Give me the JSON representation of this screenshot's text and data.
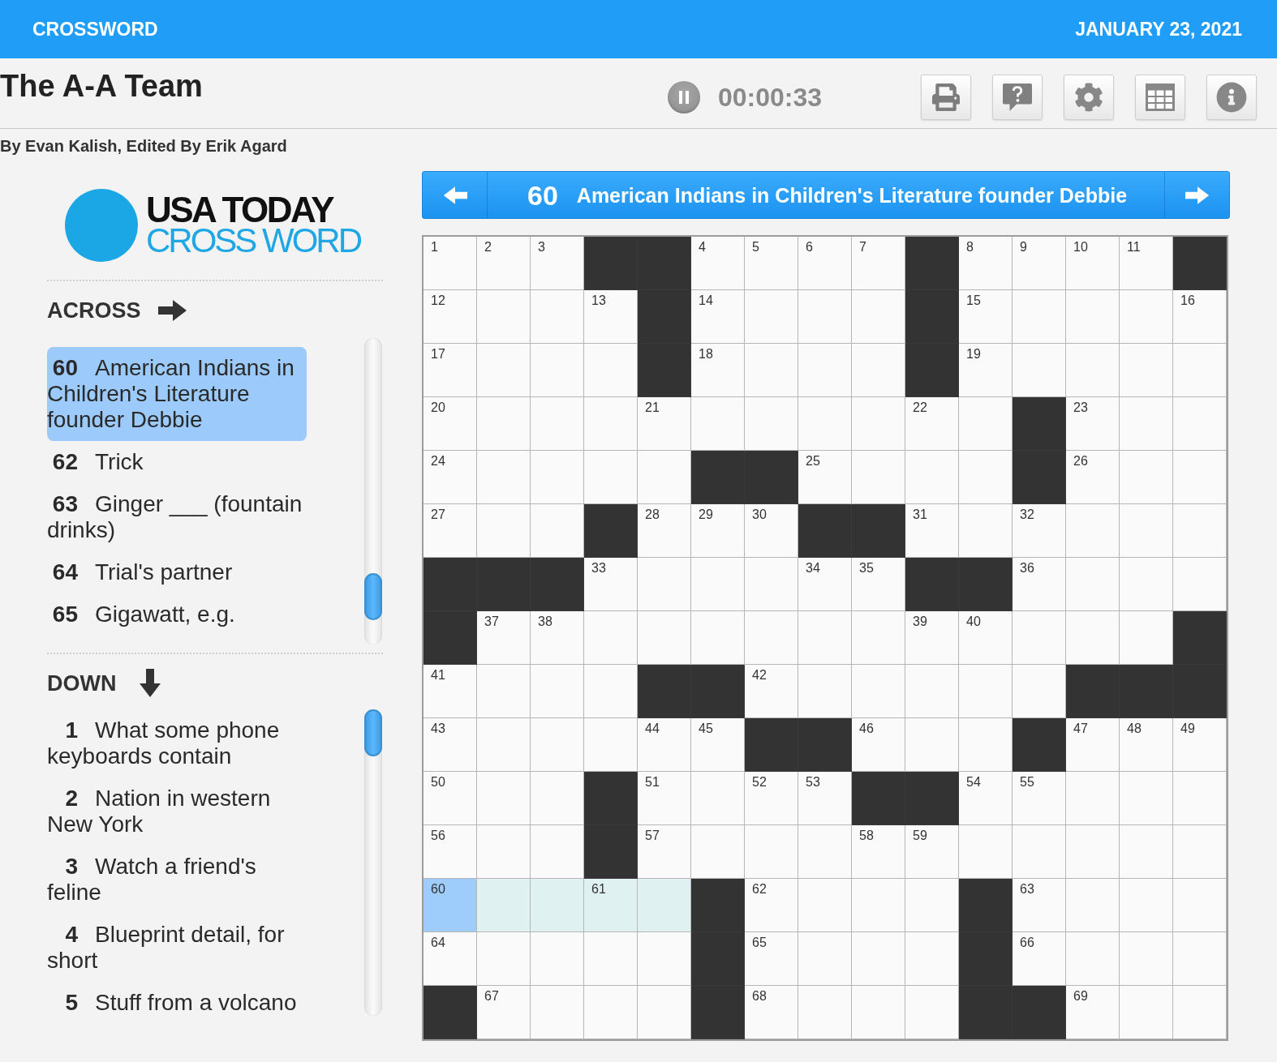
{
  "header": {
    "section": "CROSSWORD",
    "date": "JANUARY 23, 2021"
  },
  "puzzle": {
    "title": "The A-A Team",
    "byline": "By Evan Kalish, Edited By Erik Agard"
  },
  "timer": {
    "running": true,
    "time": "00:00:33"
  },
  "logo": {
    "line_1": "USA TODAY",
    "line_2": "CROSS WORD"
  },
  "across": {
    "heading": "ACROSS",
    "clues": [
      {
        "number": "60",
        "text": "American Indians in Children's Literature founder Debbie",
        "selected": true
      },
      {
        "number": "62",
        "text": "Trick",
        "selected": false
      },
      {
        "number": "63",
        "text": "Ginger ___ (fountain drinks)",
        "selected": false
      },
      {
        "number": "64",
        "text": "Trial's partner",
        "selected": false
      },
      {
        "number": "65",
        "text": "Gigawatt, e.g.",
        "selected": false
      }
    ]
  },
  "down": {
    "heading": "DOWN",
    "clues": [
      {
        "number": "1",
        "text": "What some phone keyboards contain",
        "selected": false
      },
      {
        "number": "2",
        "text": "Nation in western New York",
        "selected": false
      },
      {
        "number": "3",
        "text": "Watch a friend's feline",
        "selected": false
      },
      {
        "number": "4",
        "text": "Blueprint detail, for short",
        "selected": false
      },
      {
        "number": "5",
        "text": "Stuff from a volcano",
        "selected": false
      }
    ]
  },
  "clue_bar": {
    "number": "60",
    "text": "American Indians in Children's Literature founder Debbie"
  },
  "grid": {
    "rows": [
      [
        {
          "kind": "open",
          "number": "1",
          "selected": false,
          "highlighted": false
        },
        {
          "kind": "open",
          "number": "2",
          "selected": false,
          "highlighted": false
        },
        {
          "kind": "open",
          "number": "3",
          "selected": false,
          "highlighted": false
        },
        {
          "kind": "block"
        },
        {
          "kind": "block"
        },
        {
          "kind": "open",
          "number": "4",
          "selected": false,
          "highlighted": false
        },
        {
          "kind": "open",
          "number": "5",
          "selected": false,
          "highlighted": false
        },
        {
          "kind": "open",
          "number": "6",
          "selected": false,
          "highlighted": false
        },
        {
          "kind": "open",
          "number": "7",
          "selected": false,
          "highlighted": false
        },
        {
          "kind": "block"
        },
        {
          "kind": "open",
          "number": "8",
          "selected": false,
          "highlighted": false
        },
        {
          "kind": "open",
          "number": "9",
          "selected": false,
          "highlighted": false
        },
        {
          "kind": "open",
          "number": "10",
          "selected": false,
          "highlighted": false
        },
        {
          "kind": "open",
          "number": "11",
          "selected": false,
          "highlighted": false
        },
        {
          "kind": "block"
        }
      ],
      [
        {
          "kind": "open",
          "number": "12",
          "selected": false,
          "highlighted": false
        },
        {
          "kind": "open",
          "selected": false,
          "highlighted": false
        },
        {
          "kind": "open",
          "selected": false,
          "highlighted": false
        },
        {
          "kind": "open",
          "number": "13",
          "selected": false,
          "highlighted": false
        },
        {
          "kind": "block"
        },
        {
          "kind": "open",
          "number": "14",
          "selected": false,
          "highlighted": false
        },
        {
          "kind": "open",
          "selected": false,
          "highlighted": false
        },
        {
          "kind": "open",
          "selected": false,
          "highlighted": false
        },
        {
          "kind": "open",
          "selected": false,
          "highlighted": false
        },
        {
          "kind": "block"
        },
        {
          "kind": "open",
          "number": "15",
          "selected": false,
          "highlighted": false
        },
        {
          "kind": "open",
          "selected": false,
          "highlighted": false
        },
        {
          "kind": "open",
          "selected": false,
          "highlighted": false
        },
        {
          "kind": "open",
          "selected": false,
          "highlighted": false
        },
        {
          "kind": "open",
          "number": "16",
          "selected": false,
          "highlighted": false
        }
      ],
      [
        {
          "kind": "open",
          "number": "17",
          "selected": false,
          "highlighted": false
        },
        {
          "kind": "open",
          "selected": false,
          "highlighted": false
        },
        {
          "kind": "open",
          "selected": false,
          "highlighted": false
        },
        {
          "kind": "open",
          "selected": false,
          "highlighted": false
        },
        {
          "kind": "block"
        },
        {
          "kind": "open",
          "number": "18",
          "selected": false,
          "highlighted": false
        },
        {
          "kind": "open",
          "selected": false,
          "highlighted": false
        },
        {
          "kind": "open",
          "selected": false,
          "highlighted": false
        },
        {
          "kind": "open",
          "selected": false,
          "highlighted": false
        },
        {
          "kind": "block"
        },
        {
          "kind": "open",
          "number": "19",
          "selected": false,
          "highlighted": false
        },
        {
          "kind": "open",
          "selected": false,
          "highlighted": false
        },
        {
          "kind": "open",
          "selected": false,
          "highlighted": false
        },
        {
          "kind": "open",
          "selected": false,
          "highlighted": false
        },
        {
          "kind": "open",
          "selected": false,
          "highlighted": false
        }
      ],
      [
        {
          "kind": "open",
          "number": "20",
          "selected": false,
          "highlighted": false
        },
        {
          "kind": "open",
          "selected": false,
          "highlighted": false
        },
        {
          "kind": "open",
          "selected": false,
          "highlighted": false
        },
        {
          "kind": "open",
          "selected": false,
          "highlighted": false
        },
        {
          "kind": "open",
          "number": "21",
          "selected": false,
          "highlighted": false
        },
        {
          "kind": "open",
          "selected": false,
          "highlighted": false
        },
        {
          "kind": "open",
          "selected": false,
          "highlighted": false
        },
        {
          "kind": "open",
          "selected": false,
          "highlighted": false
        },
        {
          "kind": "open",
          "selected": false,
          "highlighted": false
        },
        {
          "kind": "open",
          "number": "22",
          "selected": false,
          "highlighted": false
        },
        {
          "kind": "open",
          "selected": false,
          "highlighted": false
        },
        {
          "kind": "block"
        },
        {
          "kind": "open",
          "number": "23",
          "selected": false,
          "highlighted": false
        },
        {
          "kind": "open",
          "selected": false,
          "highlighted": false
        },
        {
          "kind": "open",
          "selected": false,
          "highlighted": false
        }
      ],
      [
        {
          "kind": "open",
          "number": "24",
          "selected": false,
          "highlighted": false
        },
        {
          "kind": "open",
          "selected": false,
          "highlighted": false
        },
        {
          "kind": "open",
          "selected": false,
          "highlighted": false
        },
        {
          "kind": "open",
          "selected": false,
          "highlighted": false
        },
        {
          "kind": "open",
          "selected": false,
          "highlighted": false
        },
        {
          "kind": "block"
        },
        {
          "kind": "block"
        },
        {
          "kind": "open",
          "number": "25",
          "selected": false,
          "highlighted": false
        },
        {
          "kind": "open",
          "selected": false,
          "highlighted": false
        },
        {
          "kind": "open",
          "selected": false,
          "highlighted": false
        },
        {
          "kind": "open",
          "selected": false,
          "highlighted": false
        },
        {
          "kind": "block"
        },
        {
          "kind": "open",
          "number": "26",
          "selected": false,
          "highlighted": false
        },
        {
          "kind": "open",
          "selected": false,
          "highlighted": false
        },
        {
          "kind": "open",
          "selected": false,
          "highlighted": false
        }
      ],
      [
        {
          "kind": "open",
          "number": "27",
          "selected": false,
          "highlighted": false
        },
        {
          "kind": "open",
          "selected": false,
          "highlighted": false
        },
        {
          "kind": "open",
          "selected": false,
          "highlighted": false
        },
        {
          "kind": "block"
        },
        {
          "kind": "open",
          "number": "28",
          "selected": false,
          "highlighted": false
        },
        {
          "kind": "open",
          "number": "29",
          "selected": false,
          "highlighted": false
        },
        {
          "kind": "open",
          "number": "30",
          "selected": false,
          "highlighted": false
        },
        {
          "kind": "block"
        },
        {
          "kind": "block"
        },
        {
          "kind": "open",
          "number": "31",
          "selected": false,
          "highlighted": false
        },
        {
          "kind": "open",
          "selected": false,
          "highlighted": false
        },
        {
          "kind": "open",
          "number": "32",
          "selected": false,
          "highlighted": false
        },
        {
          "kind": "open",
          "selected": false,
          "highlighted": false
        },
        {
          "kind": "open",
          "selected": false,
          "highlighted": false
        },
        {
          "kind": "open",
          "selected": false,
          "highlighted": false
        }
      ],
      [
        {
          "kind": "block"
        },
        {
          "kind": "block"
        },
        {
          "kind": "block"
        },
        {
          "kind": "open",
          "number": "33",
          "selected": false,
          "highlighted": false
        },
        {
          "kind": "open",
          "selected": false,
          "highlighted": false
        },
        {
          "kind": "open",
          "selected": false,
          "highlighted": false
        },
        {
          "kind": "open",
          "selected": false,
          "highlighted": false
        },
        {
          "kind": "open",
          "number": "34",
          "selected": false,
          "highlighted": false
        },
        {
          "kind": "open",
          "number": "35",
          "selected": false,
          "highlighted": false
        },
        {
          "kind": "block"
        },
        {
          "kind": "block"
        },
        {
          "kind": "open",
          "number": "36",
          "selected": false,
          "highlighted": false
        },
        {
          "kind": "open",
          "selected": false,
          "highlighted": false
        },
        {
          "kind": "open",
          "selected": false,
          "highlighted": false
        },
        {
          "kind": "open",
          "selected": false,
          "highlighted": false
        }
      ],
      [
        {
          "kind": "block"
        },
        {
          "kind": "open",
          "number": "37",
          "selected": false,
          "highlighted": false
        },
        {
          "kind": "open",
          "number": "38",
          "selected": false,
          "highlighted": false
        },
        {
          "kind": "open",
          "selected": false,
          "highlighted": false
        },
        {
          "kind": "open",
          "selected": false,
          "highlighted": false
        },
        {
          "kind": "open",
          "selected": false,
          "highlighted": false
        },
        {
          "kind": "open",
          "selected": false,
          "highlighted": false
        },
        {
          "kind": "open",
          "selected": false,
          "highlighted": false
        },
        {
          "kind": "open",
          "selected": false,
          "highlighted": false
        },
        {
          "kind": "open",
          "number": "39",
          "selected": false,
          "highlighted": false
        },
        {
          "kind": "open",
          "number": "40",
          "selected": false,
          "highlighted": false
        },
        {
          "kind": "open",
          "selected": false,
          "highlighted": false
        },
        {
          "kind": "open",
          "selected": false,
          "highlighted": false
        },
        {
          "kind": "open",
          "selected": false,
          "highlighted": false
        },
        {
          "kind": "block"
        }
      ],
      [
        {
          "kind": "open",
          "number": "41",
          "selected": false,
          "highlighted": false
        },
        {
          "kind": "open",
          "selected": false,
          "highlighted": false
        },
        {
          "kind": "open",
          "selected": false,
          "highlighted": false
        },
        {
          "kind": "open",
          "selected": false,
          "highlighted": false
        },
        {
          "kind": "block"
        },
        {
          "kind": "block"
        },
        {
          "kind": "open",
          "number": "42",
          "selected": false,
          "highlighted": false
        },
        {
          "kind": "open",
          "selected": false,
          "highlighted": false
        },
        {
          "kind": "open",
          "selected": false,
          "highlighted": false
        },
        {
          "kind": "open",
          "selected": false,
          "highlighted": false
        },
        {
          "kind": "open",
          "selected": false,
          "highlighted": false
        },
        {
          "kind": "open",
          "selected": false,
          "highlighted": false
        },
        {
          "kind": "block"
        },
        {
          "kind": "block"
        },
        {
          "kind": "block"
        }
      ],
      [
        {
          "kind": "open",
          "number": "43",
          "selected": false,
          "highlighted": false
        },
        {
          "kind": "open",
          "selected": false,
          "highlighted": false
        },
        {
          "kind": "open",
          "selected": false,
          "highlighted": false
        },
        {
          "kind": "open",
          "selected": false,
          "highlighted": false
        },
        {
          "kind": "open",
          "number": "44",
          "selected": false,
          "highlighted": false
        },
        {
          "kind": "open",
          "number": "45",
          "selected": false,
          "highlighted": false
        },
        {
          "kind": "block"
        },
        {
          "kind": "block"
        },
        {
          "kind": "open",
          "number": "46",
          "selected": false,
          "highlighted": false
        },
        {
          "kind": "open",
          "selected": false,
          "highlighted": false
        },
        {
          "kind": "open",
          "selected": false,
          "highlighted": false
        },
        {
          "kind": "block"
        },
        {
          "kind": "open",
          "number": "47",
          "selected": false,
          "highlighted": false
        },
        {
          "kind": "open",
          "number": "48",
          "selected": false,
          "highlighted": false
        },
        {
          "kind": "open",
          "number": "49",
          "selected": false,
          "highlighted": false
        }
      ],
      [
        {
          "kind": "open",
          "number": "50",
          "selected": false,
          "highlighted": false
        },
        {
          "kind": "open",
          "selected": false,
          "highlighted": false
        },
        {
          "kind": "open",
          "selected": false,
          "highlighted": false
        },
        {
          "kind": "block"
        },
        {
          "kind": "open",
          "number": "51",
          "selected": false,
          "highlighted": false
        },
        {
          "kind": "open",
          "selected": false,
          "highlighted": false
        },
        {
          "kind": "open",
          "number": "52",
          "selected": false,
          "highlighted": false
        },
        {
          "kind": "open",
          "number": "53",
          "selected": false,
          "highlighted": false
        },
        {
          "kind": "block"
        },
        {
          "kind": "block"
        },
        {
          "kind": "open",
          "number": "54",
          "selected": false,
          "highlighted": false
        },
        {
          "kind": "open",
          "number": "55",
          "selected": false,
          "highlighted": false
        },
        {
          "kind": "open",
          "selected": false,
          "highlighted": false
        },
        {
          "kind": "open",
          "selected": false,
          "highlighted": false
        },
        {
          "kind": "open",
          "selected": false,
          "highlighted": false
        }
      ],
      [
        {
          "kind": "open",
          "number": "56",
          "selected": false,
          "highlighted": false
        },
        {
          "kind": "open",
          "selected": false,
          "highlighted": false
        },
        {
          "kind": "open",
          "selected": false,
          "highlighted": false
        },
        {
          "kind": "block"
        },
        {
          "kind": "open",
          "number": "57",
          "selected": false,
          "highlighted": false
        },
        {
          "kind": "open",
          "selected": false,
          "highlighted": false
        },
        {
          "kind": "open",
          "selected": false,
          "highlighted": false
        },
        {
          "kind": "open",
          "selected": false,
          "highlighted": false
        },
        {
          "kind": "open",
          "number": "58",
          "selected": false,
          "highlighted": false
        },
        {
          "kind": "open",
          "number": "59",
          "selected": false,
          "highlighted": false
        },
        {
          "kind": "open",
          "selected": false,
          "highlighted": false
        },
        {
          "kind": "open",
          "selected": false,
          "highlighted": false
        },
        {
          "kind": "open",
          "selected": false,
          "highlighted": false
        },
        {
          "kind": "open",
          "selected": false,
          "highlighted": false
        },
        {
          "kind": "open",
          "selected": false,
          "highlighted": false
        }
      ],
      [
        {
          "kind": "open",
          "number": "60",
          "selected": true,
          "highlighted": false
        },
        {
          "kind": "open",
          "selected": false,
          "highlighted": true
        },
        {
          "kind": "open",
          "selected": false,
          "highlighted": true
        },
        {
          "kind": "open",
          "number": "61",
          "selected": false,
          "highlighted": true
        },
        {
          "kind": "open",
          "selected": false,
          "highlighted": true
        },
        {
          "kind": "block"
        },
        {
          "kind": "open",
          "number": "62",
          "selected": false,
          "highlighted": false
        },
        {
          "kind": "open",
          "selected": false,
          "highlighted": false
        },
        {
          "kind": "open",
          "selected": false,
          "highlighted": false
        },
        {
          "kind": "open",
          "selected": false,
          "highlighted": false
        },
        {
          "kind": "block"
        },
        {
          "kind": "open",
          "number": "63",
          "selected": false,
          "highlighted": false
        },
        {
          "kind": "open",
          "selected": false,
          "highlighted": false
        },
        {
          "kind": "open",
          "selected": false,
          "highlighted": false
        },
        {
          "kind": "open",
          "selected": false,
          "highlighted": false
        }
      ],
      [
        {
          "kind": "open",
          "number": "64",
          "selected": false,
          "highlighted": false
        },
        {
          "kind": "open",
          "selected": false,
          "highlighted": false
        },
        {
          "kind": "open",
          "selected": false,
          "highlighted": false
        },
        {
          "kind": "open",
          "selected": false,
          "highlighted": false
        },
        {
          "kind": "open",
          "selected": false,
          "highlighted": false
        },
        {
          "kind": "block"
        },
        {
          "kind": "open",
          "number": "65",
          "selected": false,
          "highlighted": false
        },
        {
          "kind": "open",
          "selected": false,
          "highlighted": false
        },
        {
          "kind": "open",
          "selected": false,
          "highlighted": false
        },
        {
          "kind": "open",
          "selected": false,
          "highlighted": false
        },
        {
          "kind": "block"
        },
        {
          "kind": "open",
          "number": "66",
          "selected": false,
          "highlighted": false
        },
        {
          "kind": "open",
          "selected": false,
          "highlighted": false
        },
        {
          "kind": "open",
          "selected": false,
          "highlighted": false
        },
        {
          "kind": "open",
          "selected": false,
          "highlighted": false
        }
      ],
      [
        {
          "kind": "block"
        },
        {
          "kind": "open",
          "number": "67",
          "selected": false,
          "highlighted": false
        },
        {
          "kind": "open",
          "selected": false,
          "highlighted": false
        },
        {
          "kind": "open",
          "selected": false,
          "highlighted": false
        },
        {
          "kind": "open",
          "selected": false,
          "highlighted": false
        },
        {
          "kind": "block"
        },
        {
          "kind": "open",
          "number": "68",
          "selected": false,
          "highlighted": false
        },
        {
          "kind": "open",
          "selected": false,
          "highlighted": false
        },
        {
          "kind": "open",
          "selected": false,
          "highlighted": false
        },
        {
          "kind": "open",
          "selected": false,
          "highlighted": false
        },
        {
          "kind": "block"
        },
        {
          "kind": "block"
        },
        {
          "kind": "open",
          "number": "69",
          "selected": false,
          "highlighted": false
        },
        {
          "kind": "open",
          "selected": false,
          "highlighted": false
        },
        {
          "kind": "open",
          "selected": false,
          "highlighted": false
        }
      ]
    ]
  }
}
